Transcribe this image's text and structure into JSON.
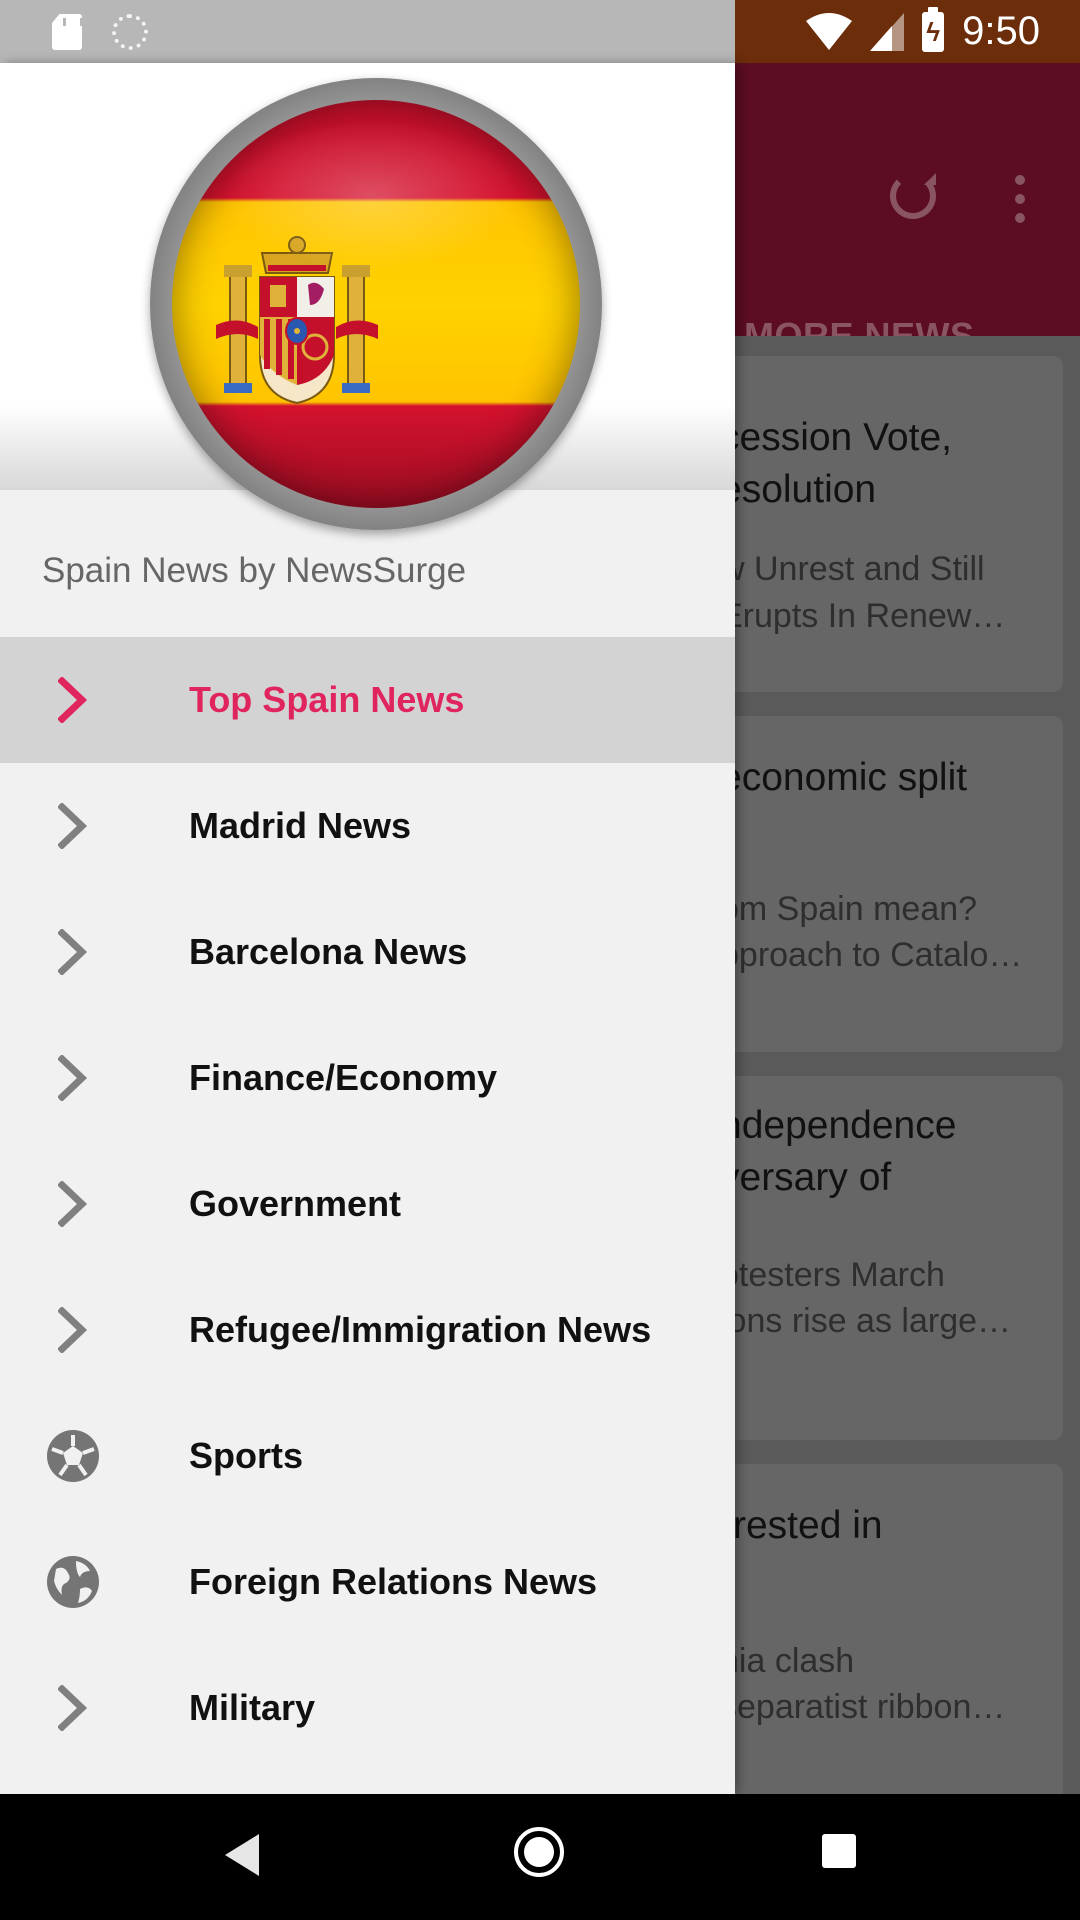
{
  "status_bar": {
    "time": "9:50",
    "battery_glyph": "ϟ"
  },
  "app_bar": {
    "tab_label": "MORE NEWS"
  },
  "cards": [
    {
      "title_lines": [
        "cession Vote,",
        "esolution"
      ],
      "body_lines": [
        "w Unrest and Still",
        "Erupts In Renew…"
      ]
    },
    {
      "title_lines": [
        "economic split",
        ""
      ],
      "body_lines": [
        "om Spain mean?",
        "pproach to Catalo…"
      ]
    },
    {
      "title_lines": [
        "ndependence",
        "versary of"
      ],
      "body_lines": [
        "otesters March",
        "ions rise as large…"
      ]
    },
    {
      "title_lines": [
        "rrested in",
        ""
      ],
      "body_lines": [
        "nia clash",
        "separatist ribbon…"
      ]
    }
  ],
  "drawer": {
    "app_name": "Spain News by NewsSurge",
    "items": [
      {
        "label": "Top Spain News",
        "icon": "chevron-right-icon",
        "active": true
      },
      {
        "label": "Madrid News",
        "icon": "chevron-right-icon"
      },
      {
        "label": "Barcelona News",
        "icon": "chevron-right-icon"
      },
      {
        "label": "Finance/Economy",
        "icon": "chevron-right-icon"
      },
      {
        "label": "Government",
        "icon": "chevron-right-icon"
      },
      {
        "label": "Refugee/Immigration News",
        "icon": "chevron-right-icon"
      },
      {
        "label": "Sports",
        "icon": "soccer-ball-icon"
      },
      {
        "label": "Foreign Relations News",
        "icon": "globe-icon"
      },
      {
        "label": "Military",
        "icon": "chevron-right-icon"
      }
    ]
  },
  "colors": {
    "accent": "#e0245e",
    "app_bar": "#5c0d21",
    "active_item_bg": "#d3d3d3"
  }
}
